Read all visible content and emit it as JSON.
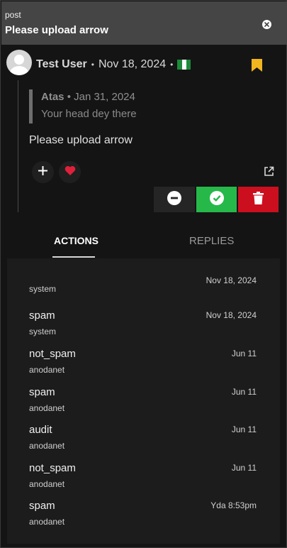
{
  "header": {
    "kind": "post",
    "title": "Please upload arrow"
  },
  "post": {
    "author": "Test User",
    "date": "Nov 18, 2024",
    "flag": "nigeria-flag",
    "quote": {
      "author": "Atas",
      "date": "Jan 31, 2024",
      "text": "Your head dey there"
    },
    "body": "Please upload arrow"
  },
  "colors": {
    "approve": "#27b84a",
    "delete": "#cc0f1f",
    "bookmark": "#f2b51f",
    "heart": "#e0203a",
    "flag_green": "#1e8a3a"
  },
  "icons": {
    "close": "close-icon",
    "bookmark": "bookmark-icon",
    "add": "plus-icon",
    "react": "heart-icon",
    "external": "external-link-icon",
    "remove": "minus-circle-icon",
    "approve": "check-circle-icon",
    "delete": "trash-icon"
  },
  "tabs": {
    "actions": "ACTIONS",
    "replies": "REPLIES"
  },
  "actions": [
    {
      "action": "",
      "actor": "system",
      "time": "Nov 18, 2024"
    },
    {
      "action": "spam",
      "actor": "system",
      "time": "Nov 18, 2024"
    },
    {
      "action": "not_spam",
      "actor": "anodanet",
      "time": "Jun 11"
    },
    {
      "action": "spam",
      "actor": "anodanet",
      "time": "Jun 11"
    },
    {
      "action": "audit",
      "actor": "anodanet",
      "time": "Jun 11"
    },
    {
      "action": "not_spam",
      "actor": "anodanet",
      "time": "Jun 11"
    },
    {
      "action": "spam",
      "actor": "anodanet",
      "time": "Yda 8:53pm"
    }
  ]
}
